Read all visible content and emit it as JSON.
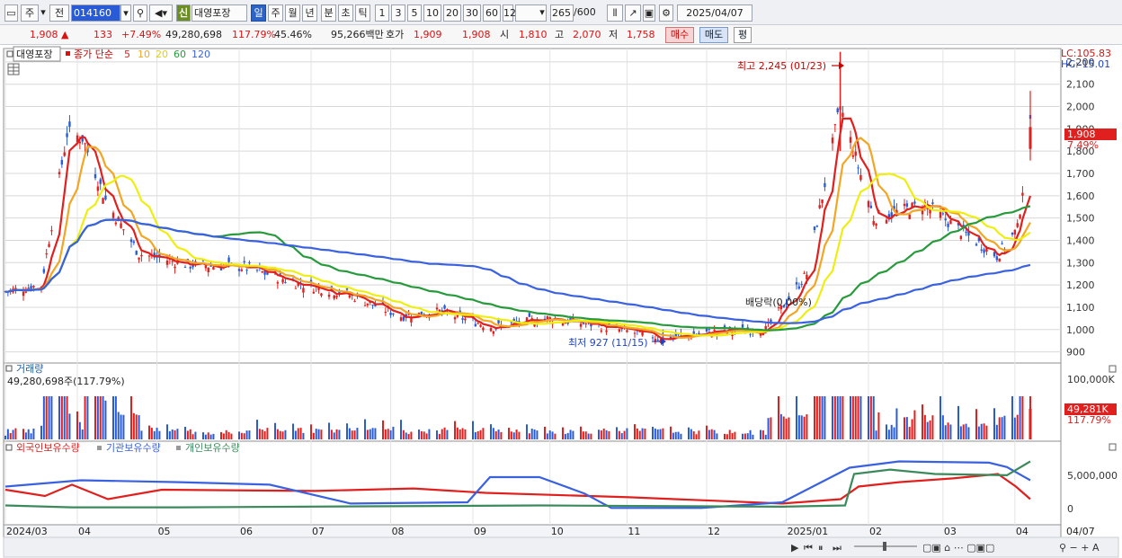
{
  "toolbar": {
    "mode1": "주",
    "mode2": "전",
    "code": "014160",
    "badge": "신",
    "stock_name": "대영포장",
    "periods": [
      "일",
      "주",
      "월",
      "년",
      "분",
      "초",
      "틱"
    ],
    "intervals": [
      "1",
      "3",
      "5",
      "10",
      "20",
      "30",
      "60",
      "120"
    ],
    "count": "265",
    "count_total": "/600",
    "date": "2025/04/07"
  },
  "info": {
    "price": "1,908",
    "change": "133",
    "change_pct": "+7.49%",
    "volume": "49,280,698",
    "vol_ratio": "117.79%",
    "turnover": "45.46%",
    "amount": "95,266백만",
    "quote_label": "호가",
    "ask": "1,909",
    "bid": "1,908",
    "open_label": "시",
    "open": "1,810",
    "high_label": "고",
    "high": "2,070",
    "low_label": "저",
    "low": "1,758",
    "buy_label": "매수",
    "sell_label": "매도",
    "eval_label": "평"
  },
  "price_panel": {
    "legend_name": "대영포장",
    "legend_prefix": "종가 단순",
    "ma": [
      {
        "label": "5",
        "color": "#e0201e"
      },
      {
        "label": "10",
        "color": "#f2a623"
      },
      {
        "label": "20",
        "color": "#eeee11"
      },
      {
        "label": "60",
        "color": "#279a3c"
      },
      {
        "label": "120",
        "color": "#3a61e0"
      }
    ],
    "lc": "LC:105.83",
    "hc": "HC:-15.01",
    "yticks": [
      "2,200",
      "2,100",
      "2,000",
      "1,900",
      "1,800",
      "1,700",
      "1,600",
      "1,500",
      "1,400",
      "1,300",
      "1,200",
      "1,100",
      "1,000",
      "900"
    ],
    "current_price": "1,908",
    "current_pct": "7.49%",
    "high_annot": "최고 2,245 (01/23)",
    "low_annot": "최저 927 (11/15)",
    "div_annot": "배당락(0.00%)"
  },
  "volume_panel": {
    "title": "거래량",
    "value": "49,280,698주(117.79%)",
    "ytick": "100,000K",
    "current": "49,281K",
    "current_pct": "117.79%"
  },
  "holdings_panel": {
    "series": [
      {
        "label": "외국인보유수량",
        "color": "#e0201e"
      },
      {
        "label": "기관보유수량",
        "color": "#3a61e0"
      },
      {
        "label": "개인보유수량",
        "color": "#3a8a5c"
      }
    ],
    "yticks": [
      "5,000,000",
      "0"
    ]
  },
  "xaxis": {
    "labels": [
      "2024/03",
      "04",
      "05",
      "06",
      "07",
      "08",
      "09",
      "10",
      "11",
      "12",
      "2025/01",
      "02",
      "03",
      "04",
      "04/07"
    ]
  },
  "chart_data": {
    "type": "candlestick",
    "ylim": [
      850,
      2260
    ],
    "x_months": [
      "2024/03",
      "2024/04",
      "2024/05",
      "2024/06",
      "2024/07",
      "2024/08",
      "2024/09",
      "2024/10",
      "2024/11",
      "2024/12",
      "2025/01",
      "2025/02",
      "2025/03",
      "2025/04"
    ],
    "close_trend": [
      {
        "date": "2024/03/04",
        "close": 1170
      },
      {
        "date": "2024/03/18",
        "close": 1200
      },
      {
        "date": "2024/03/28",
        "close": 1880
      },
      {
        "date": "2024/04/03",
        "close": 1860
      },
      {
        "date": "2024/04/12",
        "close": 1580
      },
      {
        "date": "2024/04/25",
        "close": 1340
      },
      {
        "date": "2024/05/15",
        "close": 1290
      },
      {
        "date": "2024/06/05",
        "close": 1280
      },
      {
        "date": "2024/06/25",
        "close": 1210
      },
      {
        "date": "2024/07/15",
        "close": 1160
      },
      {
        "date": "2024/08/05",
        "close": 1060
      },
      {
        "date": "2024/08/20",
        "close": 1080
      },
      {
        "date": "2024/09/10",
        "close": 1010
      },
      {
        "date": "2024/10/01",
        "close": 1050
      },
      {
        "date": "2024/10/20",
        "close": 1020
      },
      {
        "date": "2024/11/15",
        "close": 960
      },
      {
        "date": "2024/12/05",
        "close": 990
      },
      {
        "date": "2024/12/25",
        "close": 1000
      },
      {
        "date": "2025/01/10",
        "close": 1250
      },
      {
        "date": "2025/01/23",
        "close": 2000
      },
      {
        "date": "2025/02/05",
        "close": 1500
      },
      {
        "date": "2025/02/25",
        "close": 1560
      },
      {
        "date": "2025/03/10",
        "close": 1450
      },
      {
        "date": "2025/03/25",
        "close": 1330
      },
      {
        "date": "2025/04/02",
        "close": 1450
      },
      {
        "date": "2025/04/07",
        "close": 1908
      }
    ],
    "highest": {
      "value": 2245,
      "date": "01/23"
    },
    "lowest": {
      "value": 927,
      "date": "11/15"
    },
    "last": {
      "open": 1810,
      "high": 2070,
      "low": 1758,
      "close": 1908,
      "volume": 49280698
    },
    "moving_averages": [
      5,
      10,
      20,
      60,
      120
    ]
  }
}
